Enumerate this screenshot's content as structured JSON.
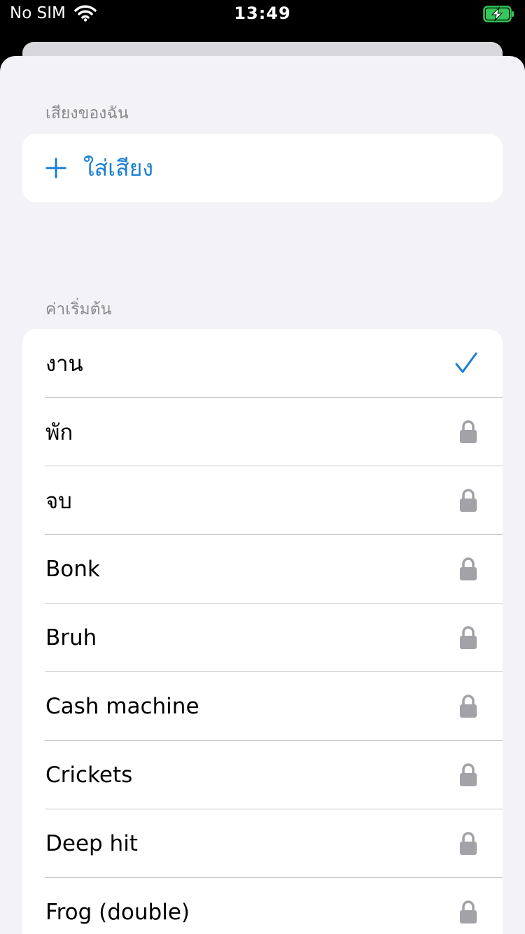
{
  "status_bar": {
    "carrier": "No SIM",
    "time": "13:49",
    "icons": [
      "wifi-icon",
      "battery-charging-icon"
    ]
  },
  "my_sounds": {
    "header": "เสียงของฉัน",
    "add_label": "ใส่เสียง",
    "add_icon": "plus-icon"
  },
  "defaults": {
    "header": "ค่าเริ่มต้น",
    "items": [
      {
        "label": "งาน",
        "icon": "checkmark-icon"
      },
      {
        "label": "พัก",
        "icon": "lock-icon"
      },
      {
        "label": "จบ",
        "icon": "lock-icon"
      },
      {
        "label": "Bonk",
        "icon": "lock-icon"
      },
      {
        "label": "Bruh",
        "icon": "lock-icon"
      },
      {
        "label": "Cash machine",
        "icon": "lock-icon"
      },
      {
        "label": "Crickets",
        "icon": "lock-icon"
      },
      {
        "label": "Deep hit",
        "icon": "lock-icon"
      },
      {
        "label": "Frog (double)",
        "icon": "lock-icon"
      }
    ]
  },
  "colors": {
    "accent": "#1a7fd4",
    "lock": "#a2a2a8",
    "battery": "#34c759"
  }
}
